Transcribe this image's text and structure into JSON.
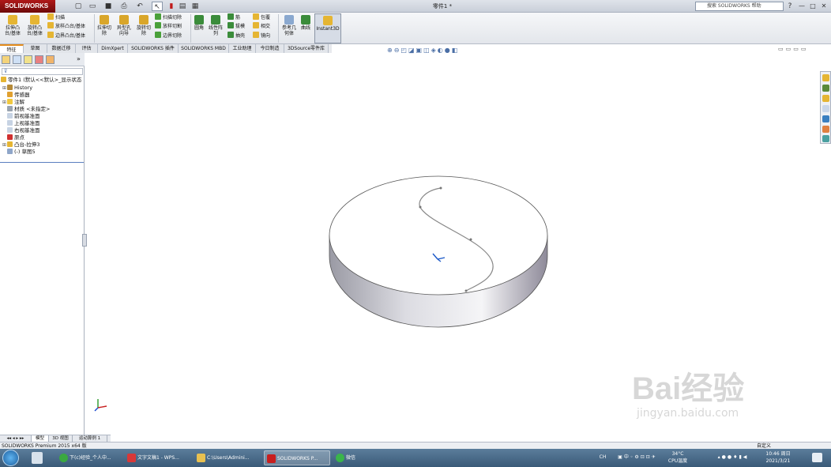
{
  "titlebar": {
    "brand": "SOLIDWORKS",
    "doc_title": "零件1 *",
    "help_search": "搜索 SOLIDWORKS 帮助",
    "help_q": "?",
    "win_min": "—",
    "win_max": "□",
    "win_close": "✕"
  },
  "ribbon": {
    "extrude_boss": "拉伸凸台/基体",
    "revolve_boss": "旋转凸台/基体",
    "sweep": "扫描",
    "loft_boss": "放样凸台/基体",
    "boundary_boss": "边界凸台/基体",
    "extrude_cut": "拉伸切除",
    "hole_wizard": "异型孔向导",
    "revolve_cut": "旋转切除",
    "swept_cut": "扫描切除",
    "lofted_cut": "放样切割",
    "boundary_cut": "边界切除",
    "fillet": "圆角",
    "linear_pattern": "线性阵列",
    "rib": "筋",
    "draft": "拔模",
    "shell": "抽壳",
    "wrap": "包覆",
    "intersect": "相交",
    "mirror": "镜向",
    "ref_geometry": "参考几何体",
    "curves": "曲线",
    "instant3d": "Instant3D"
  },
  "tabs": [
    "特征",
    "草图",
    "数据迁移",
    "评估",
    "DimXpert",
    "SOLIDWORKS 插件",
    "SOLIDWORKS MBD",
    "工业助理",
    "今日制造",
    "3DSource零件库"
  ],
  "tree": {
    "root": "零件1 (默认<<默认>_显示状态",
    "items": [
      "History",
      "传感器",
      "注解",
      "材质 <未指定>",
      "前视基准面",
      "上视基准面",
      "右视基准面",
      "原点",
      "凸台-拉伸3",
      "(-) 草图5"
    ]
  },
  "bottom_tabs": [
    "模型",
    "3D 视图",
    "运动算例 1"
  ],
  "status": {
    "left": "SOLIDWORKS Premium 2015 x64 版",
    "right": "自定义"
  },
  "taskbar": {
    "items": [
      "下(c)经验_个人中...",
      "文字文稿1 - WPS...",
      "C:\\Users\\Admini...",
      "SOLIDWORKS P...",
      "微信"
    ],
    "temp": "34°C",
    "temp_label": "CPU温度",
    "time": "10:46 周日",
    "date": "2021/3/21",
    "ime": "CH"
  },
  "watermark": {
    "brand": "Bai经验",
    "url": "jingyan.baidu.com"
  },
  "colors": {
    "accent": "#e38b1c",
    "brand_red": "#b01818",
    "taskbar": "#3a5a78"
  }
}
